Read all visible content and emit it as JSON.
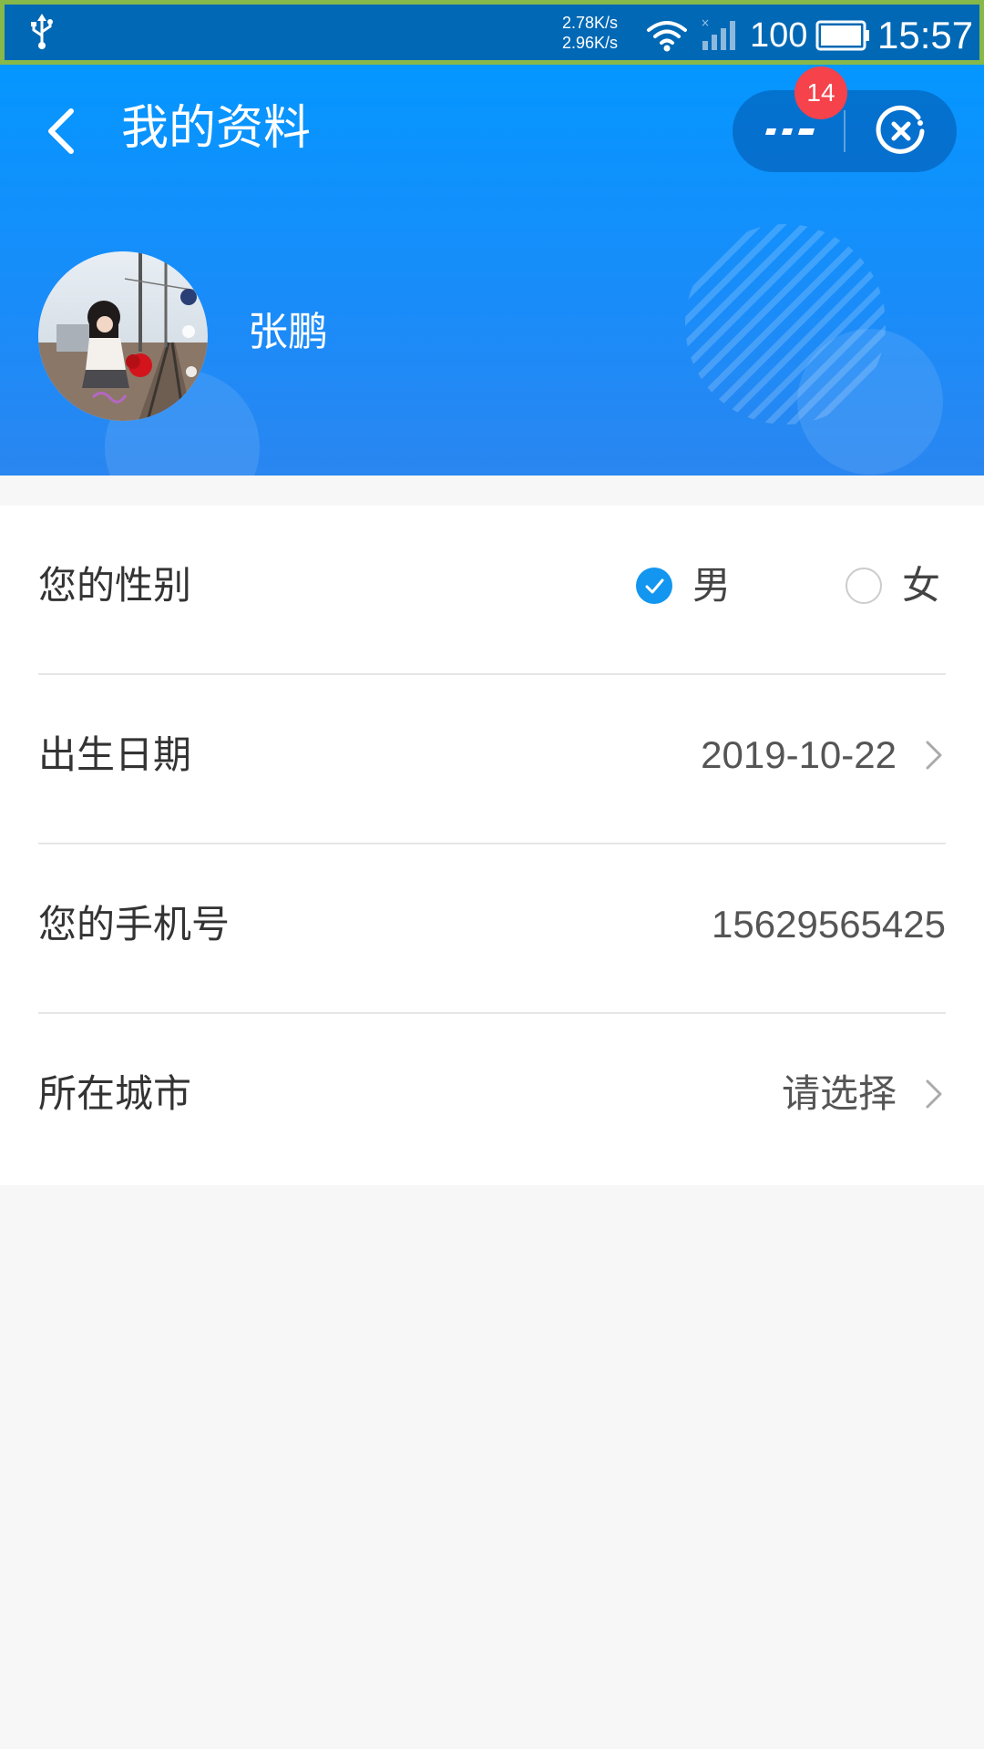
{
  "status_bar": {
    "speed_up": "2.78K/s",
    "speed_down": "2.96K/s",
    "battery_level": "100",
    "time": "15:57"
  },
  "header": {
    "title": "我的资料",
    "badge_count": "14",
    "user_name": "张鹏"
  },
  "form": {
    "gender": {
      "label": "您的性别",
      "options": [
        "男",
        "女"
      ],
      "selected": "男"
    },
    "birth_date": {
      "label": "出生日期",
      "value": "2019-10-22"
    },
    "phone": {
      "label": "您的手机号",
      "value": "15629565425"
    },
    "city": {
      "label": "所在城市",
      "value": "请选择"
    }
  },
  "colors": {
    "header_blue": "#0596ff",
    "accent": "#1296f0",
    "badge_red": "#f5424b"
  }
}
